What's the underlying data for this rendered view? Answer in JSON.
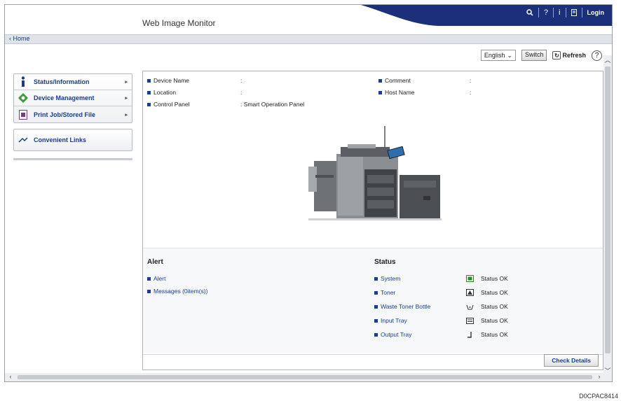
{
  "header": {
    "app_title": "Web Image Monitor",
    "icons": [
      "search-icon",
      "help-icon",
      "info-icon",
      "address-book-icon"
    ],
    "login_label": "Login",
    "accent_color": "#1c2f7a"
  },
  "breadcrumb": {
    "home_label": "Home"
  },
  "toolbar": {
    "language": "English",
    "switch_label": "Switch",
    "refresh_label": "Refresh"
  },
  "sidebar": {
    "items": [
      {
        "label": "Status/Information",
        "icon": "info-icon"
      },
      {
        "label": "Device Management",
        "icon": "device-icon"
      },
      {
        "label": "Print Job/Stored File",
        "icon": "document-icon"
      }
    ],
    "links_label": "Convenient Links"
  },
  "device_info": {
    "device_name_label": "Device Name",
    "device_name_value": ":",
    "location_label": "Location",
    "location_value": ":",
    "control_panel_label": "Control Panel",
    "control_panel_value": ": Smart Operation Panel",
    "comment_label": "Comment",
    "comment_value": ":",
    "host_name_label": "Host Name",
    "host_name_value": ":"
  },
  "alert": {
    "title": "Alert",
    "items": [
      "Alert",
      "Messages (0item(s))"
    ]
  },
  "status": {
    "title": "Status",
    "items": [
      {
        "label": "System",
        "value": "Status OK",
        "icon": "system-ok-icon"
      },
      {
        "label": "Toner",
        "value": "Status OK",
        "icon": "toner-icon"
      },
      {
        "label": "Waste Toner Bottle",
        "value": "Status OK",
        "icon": "waste-toner-icon"
      },
      {
        "label": "Input Tray",
        "value": "Status OK",
        "icon": "input-tray-icon"
      },
      {
        "label": "Output Tray",
        "value": "Status OK",
        "icon": "output-tray-icon"
      }
    ]
  },
  "check_details_label": "Check Details",
  "caption": "D0CPAC8414"
}
